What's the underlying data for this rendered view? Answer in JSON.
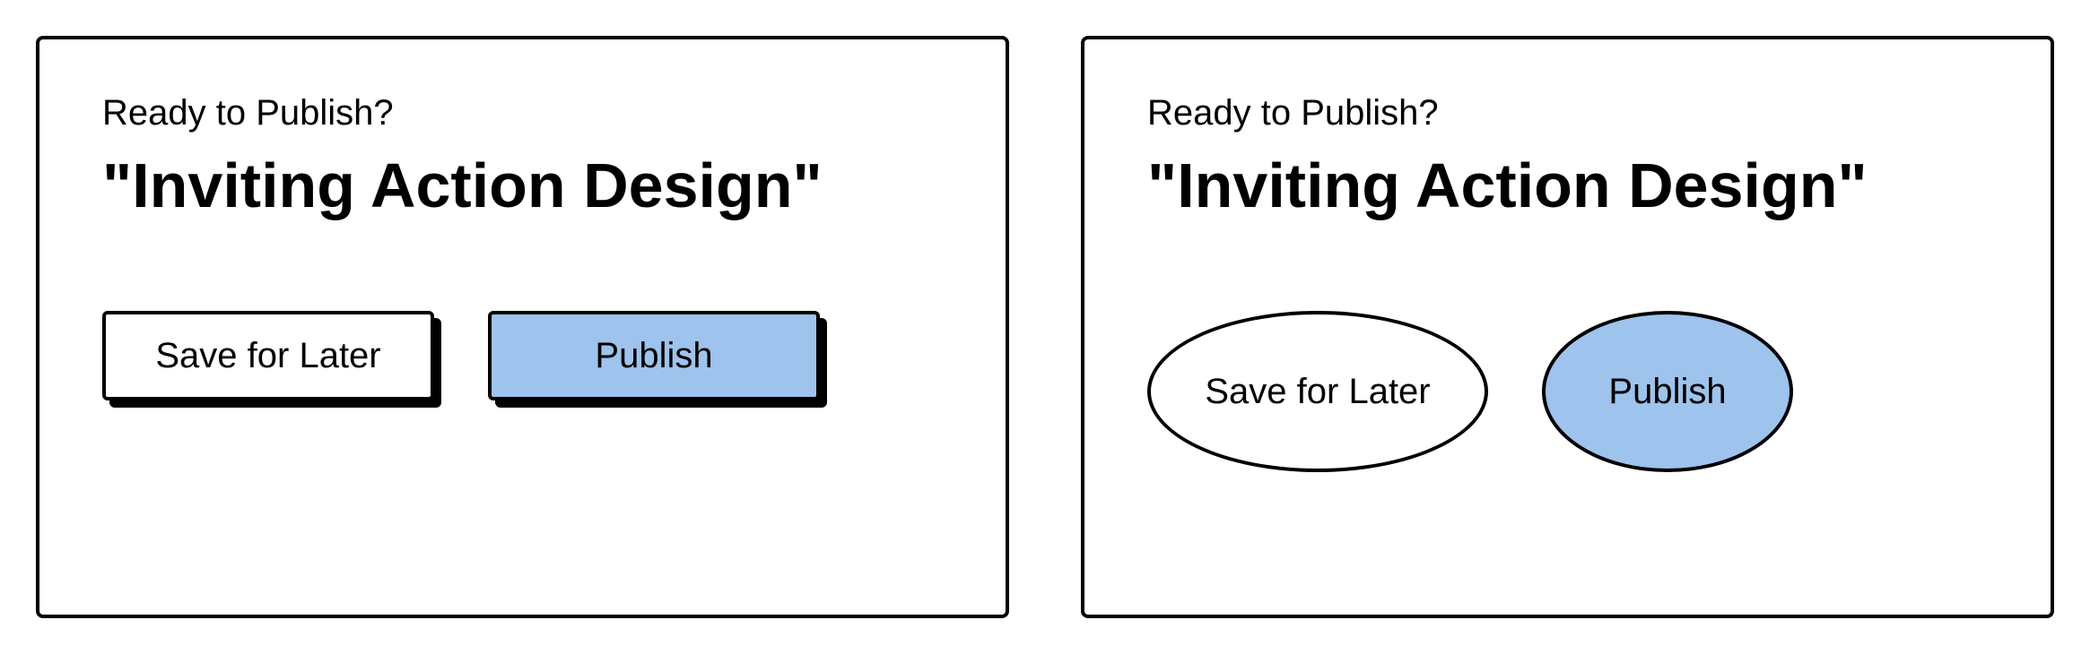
{
  "left_panel": {
    "prompt": "Ready to Publish?",
    "title": "\"Inviting Action Design\"",
    "save_label": "Save for Later",
    "publish_label": "Publish"
  },
  "right_panel": {
    "prompt": "Ready to Publish?",
    "title": "\"Inviting Action Design\"",
    "save_label": "Save for Later",
    "publish_label": "Publish"
  },
  "colors": {
    "primary_fill": "#9ec3ec",
    "stroke": "#000000"
  }
}
